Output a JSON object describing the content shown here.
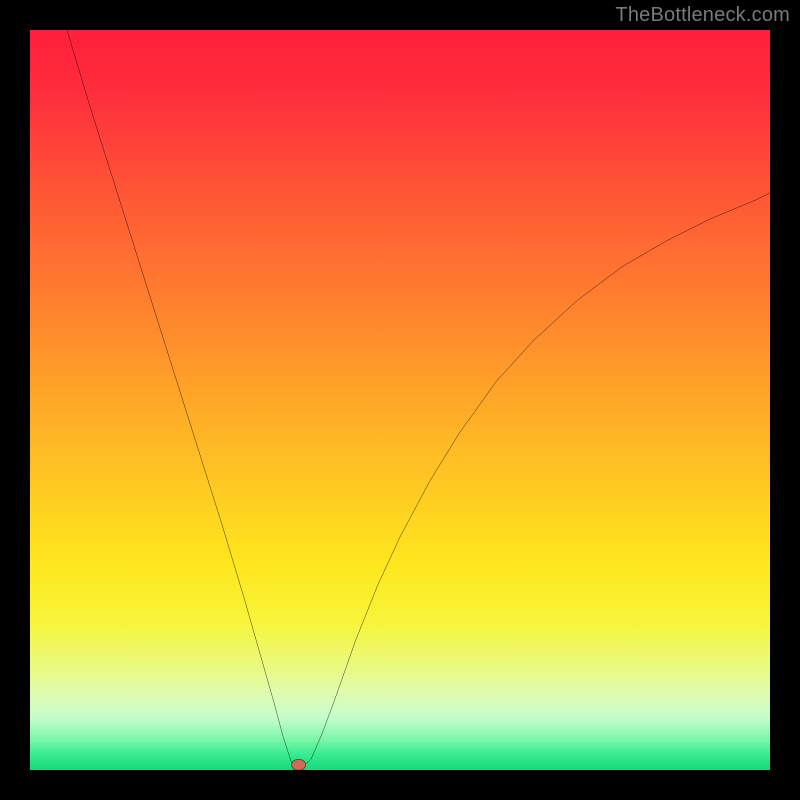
{
  "watermark": "TheBottleneck.com",
  "colors": {
    "frame": "#000000",
    "curve_stroke": "#000000",
    "marker_fill": "#cf6a5a",
    "marker_stroke": "#7b3b30"
  },
  "chart_data": {
    "type": "line",
    "title": "",
    "xlabel": "",
    "ylabel": "",
    "xlim": [
      0,
      100
    ],
    "ylim": [
      0,
      100
    ],
    "grid": false,
    "legend": false,
    "series": [
      {
        "name": "bottleneck-curve",
        "x": [
          5,
          8,
          11,
          14,
          17,
          20,
          23,
          26,
          29,
          31,
          33,
          34.2,
          35.5,
          37,
          38,
          39.5,
          41,
          44,
          47,
          50,
          54,
          58,
          63,
          68,
          74,
          80,
          86,
          92,
          98,
          100
        ],
        "y": [
          100,
          90,
          80.5,
          71,
          61.5,
          52,
          42.5,
          33,
          23,
          16,
          9,
          4.5,
          0.5,
          0.5,
          1.5,
          5,
          9,
          17.5,
          25,
          31.5,
          39,
          45.5,
          52.5,
          58,
          63.5,
          68,
          71.5,
          74.5,
          77,
          78
        ]
      }
    ],
    "annotations": [
      {
        "name": "curve-minimum-marker",
        "x": 36.3,
        "y": 0.7
      }
    ],
    "background_gradient": {
      "direction": "top-to-bottom",
      "stops": [
        {
          "pct": 0,
          "color": "#ff1f3a"
        },
        {
          "pct": 36,
          "color": "#ff7e2f"
        },
        {
          "pct": 72,
          "color": "#ffe61d"
        },
        {
          "pct": 90,
          "color": "#dcfcb5"
        },
        {
          "pct": 100,
          "color": "#17d97c"
        }
      ]
    }
  }
}
